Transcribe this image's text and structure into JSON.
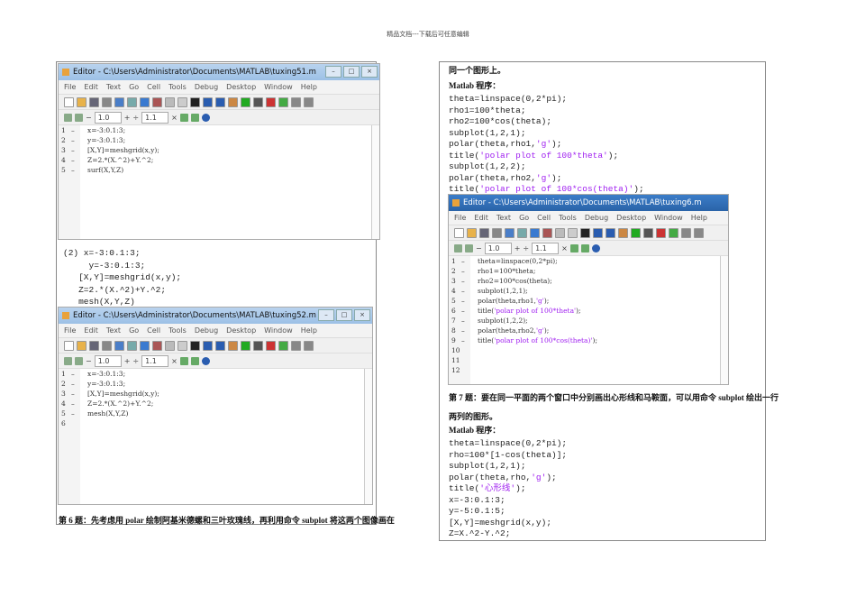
{
  "header": "精品文档---下载后可任意编辑",
  "editor_common": {
    "menu": [
      "File",
      "Edit",
      "Text",
      "Go",
      "Cell",
      "Tools",
      "Debug",
      "Desktop",
      "Window",
      "Help"
    ],
    "zoom_a": "1.0",
    "zoom_b": "1.1",
    "minus": "−",
    "plus": "+",
    "divide": "÷",
    "times": "×"
  },
  "editors": [
    {
      "title": "Editor - C:\\Users\\Administrator\\Documents\\MATLAB\\tuxing51.m",
      "lines": [
        {
          "n": "1",
          "m": "–",
          "c": "x=-3:0.1:3;"
        },
        {
          "n": "2",
          "m": "–",
          "c": "y=-3:0.1:3;"
        },
        {
          "n": "3",
          "m": "–",
          "c": "[X,Y]=meshgrid(x,y);"
        },
        {
          "n": "4",
          "m": "–",
          "c": "Z=2.*(X.^2)+Y.^2;"
        },
        {
          "n": "5",
          "m": "–",
          "c": "surf(X,Y,Z)"
        }
      ]
    },
    {
      "title": "Editor - C:\\Users\\Administrator\\Documents\\MATLAB\\tuxing52.m",
      "lines": [
        {
          "n": "1",
          "m": "–",
          "c": "x=-3:0.1:3;"
        },
        {
          "n": "2",
          "m": "–",
          "c": "y=-3:0.1:3;"
        },
        {
          "n": "3",
          "m": "–",
          "c": "[X,Y]=meshgrid(x,y);"
        },
        {
          "n": "4",
          "m": "–",
          "c": "Z=2.*(X.^2)+Y.^2;"
        },
        {
          "n": "5",
          "m": "–",
          "c": "mesh(X,Y,Z)"
        },
        {
          "n": "6",
          "m": "",
          "c": ""
        }
      ]
    },
    {
      "title": "Editor - C:\\Users\\Administrator\\Documents\\MATLAB\\tuxing6.m",
      "lines": [
        {
          "n": "1",
          "m": "–",
          "c": "theta=linspace(0,2*pi);"
        },
        {
          "n": "2",
          "m": "–",
          "c": "rho1=100*theta;"
        },
        {
          "n": "3",
          "m": "–",
          "c": "rho2=100*cos(theta);"
        },
        {
          "n": "4",
          "m": "–",
          "c": "subplot(1,2,1);"
        },
        {
          "n": "5",
          "m": "–",
          "c": "polar(theta,rho1,'g');"
        },
        {
          "n": "6",
          "m": "–",
          "c": "title('polar plot of 100*theta');"
        },
        {
          "n": "7",
          "m": "–",
          "c": "subplot(1,2,2);"
        },
        {
          "n": "8",
          "m": "–",
          "c": "polar(theta,rho2,'g');"
        },
        {
          "n": "9",
          "m": "–",
          "c": "title('polar plot of 100*cos(theta)');"
        },
        {
          "n": "10",
          "m": "",
          "c": ""
        },
        {
          "n": "11",
          "m": "",
          "c": ""
        },
        {
          "n": "12",
          "m": "",
          "c": ""
        }
      ]
    }
  ],
  "left": {
    "code2": [
      "(2) x=-3:0.1:3;",
      "     y=-3:0.1:3;",
      "   [X,Y]=meshgrid(x,y);",
      "   Z=2.*(X.^2)+Y.^2;",
      "   mesh(X,Y,Z)"
    ],
    "q6": "第 6 题：先考虑用 polar 绘制阿基米德螺和三叶玫瑰线，再利用命令 subplot 将这两个图像画在"
  },
  "right": {
    "cont": "同一个图形上。",
    "matlab_label1": "Matlab 程序：",
    "code1": [
      "theta=linspace(0,2*pi);",
      "rho1=100*theta;",
      "rho2=100*cos(theta);",
      "subplot(1,2,1);",
      "polar(theta,rho1,'g');",
      "title('polar plot of 100*theta');",
      "subplot(1,2,2);",
      "polar(theta,rho2,'g');",
      "title('polar plot of 100*cos(theta)');"
    ],
    "q7_line1": "第 7 题：要在同一平面的两个窗口中分别画出心形线和马鞍面，可以用命令 subplot 绘出一行",
    "q7_line2": "两列的图形。",
    "matlab_label2": "Matlab 程序：",
    "code2": [
      "theta=linspace(0,2*pi);",
      "rho=100*[1-cos(theta)];",
      "subplot(1,2,1);",
      "polar(theta,rho,'g');",
      "title('心形线');",
      "x=-3:0.1:3;",
      "y=-5:0.1:5;",
      "[X,Y]=meshgrid(x,y);",
      "Z=X.^2-Y.^2;"
    ]
  }
}
